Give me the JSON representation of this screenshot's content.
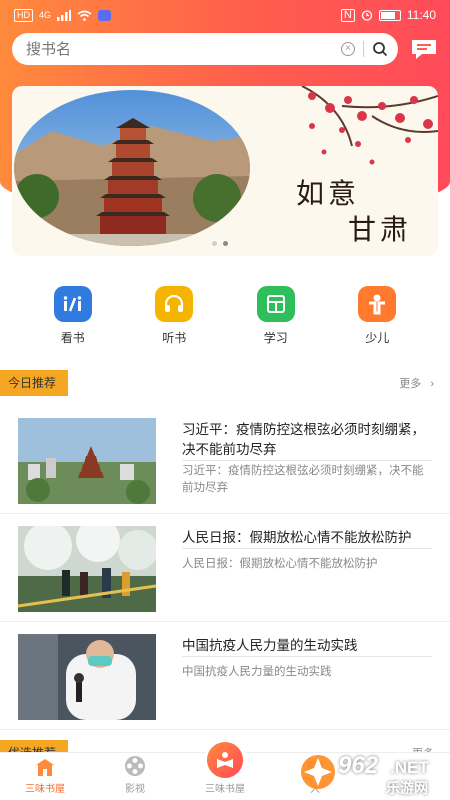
{
  "status": {
    "time": "11:40",
    "network": "4G",
    "hd": "HD"
  },
  "search": {
    "placeholder": "搜书名"
  },
  "banner": {
    "caption_line1": "如意",
    "caption_line2": "甘肃",
    "dots": 2,
    "active_dot": 1
  },
  "categories": [
    {
      "label": "看书",
      "icon": "reading-icon",
      "color": "#2f7be0"
    },
    {
      "label": "听书",
      "icon": "headphones-icon",
      "color": "#f5b400"
    },
    {
      "label": "学习",
      "icon": "study-icon",
      "color": "#2fbf5a"
    },
    {
      "label": "少儿",
      "icon": "child-icon",
      "color": "#ff7a2c"
    }
  ],
  "today": {
    "tag": "今日推荐",
    "more": "更多",
    "items": [
      {
        "title": "习近平：疫情防控这根弦必须时刻绷紧，决不能前功尽弃",
        "summary": "习近平：疫情防控这根弦必须时刻绷紧，决不能前功尽弃"
      },
      {
        "title": "人民日报：假期放松心情不能放松防护",
        "summary": "人民日报：假期放松心情不能放松防护"
      },
      {
        "title": "中国抗疫人民力量的生动实践",
        "summary": "中国抗疫人民力量的生动实践"
      }
    ]
  },
  "next_section": {
    "tag": "优选推荐",
    "more": "更多"
  },
  "tabbar": [
    {
      "label": "三味书屋",
      "icon": "bookstore-icon"
    },
    {
      "label": "影视",
      "icon": "film-icon"
    },
    {
      "label": "三味书屋",
      "icon": "reader-icon"
    },
    {
      "label": "大",
      "icon": "hall-icon"
    }
  ],
  "watermark": {
    "text1": "962",
    "text2": ".NET",
    "text3": "乐游网"
  },
  "colors": {
    "accent": "#ff6a2c",
    "tag": "#f5a623"
  }
}
